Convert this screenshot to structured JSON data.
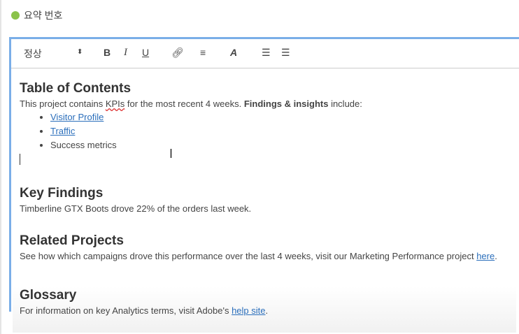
{
  "header": {
    "title": "요약 번호",
    "status_color": "#8bc34a"
  },
  "toolbar": {
    "format_select": "정상",
    "bold": "B",
    "italic": "I",
    "underline": "U",
    "icons": [
      "link-icon",
      "align-icon",
      "text-color-icon",
      "ordered-list-icon",
      "bullet-list-icon"
    ]
  },
  "content": {
    "toc": {
      "heading": "Table of Contents",
      "intro_pre": "This project contains ",
      "intro_kpi": "KPIs",
      "intro_mid": " for the most recent 4 weeks. ",
      "intro_bold": "Findings & insights",
      "intro_post": " include:",
      "items": [
        "Visitor Profile",
        "Traffic",
        "Success metrics"
      ]
    },
    "key_findings": {
      "heading": "Key Findings",
      "text": "Timberline GTX Boots drove 22% of the orders last week."
    },
    "related": {
      "heading": "Related Projects",
      "text": "See how which campaigns drove this performance over the last 4 weeks, visit our Marketing Performance project ",
      "link": "here",
      "end": "."
    },
    "glossary": {
      "heading": "Glossary",
      "text": "For information on key Analytics terms, visit Adobe's ",
      "link": "help site",
      "end": "."
    }
  }
}
